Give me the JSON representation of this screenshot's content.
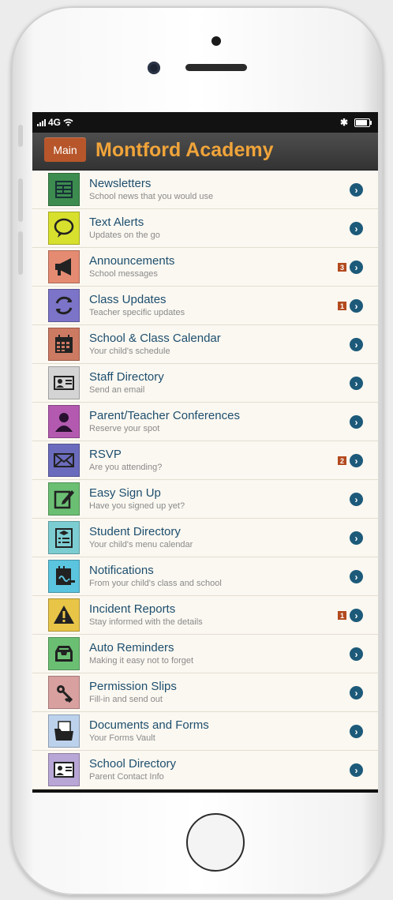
{
  "status_bar": {
    "carrier": "4G"
  },
  "header": {
    "main_button": "Main",
    "title": "Montford Academy"
  },
  "colors": {
    "accent": "#f0a43a",
    "main_button": "#b7562a",
    "badge": "#b34a1e",
    "title_text": "#1d4e6e",
    "chevron": "#1d5a7a"
  },
  "menu": [
    {
      "title": "Newsletters",
      "subtitle": "School news that you would use",
      "icon": "newsletter-icon",
      "tile_color": "#3d8c4f",
      "badge": ""
    },
    {
      "title": "Text Alerts",
      "subtitle": "Updates on the go",
      "icon": "speech-bubble-icon",
      "tile_color": "#d8e02e",
      "badge": ""
    },
    {
      "title": "Announcements",
      "subtitle": "School messages",
      "icon": "megaphone-icon",
      "tile_color": "#e58b72",
      "badge": "3"
    },
    {
      "title": "Class Updates",
      "subtitle": "Teacher specific updates",
      "icon": "refresh-icon",
      "tile_color": "#7c74c8",
      "badge": "1"
    },
    {
      "title": "School & Class Calendar",
      "subtitle": "Your child's schedule",
      "icon": "calendar-icon",
      "tile_color": "#cd7a63",
      "badge": ""
    },
    {
      "title": "Staff Directory",
      "subtitle": "Send an email",
      "icon": "id-card-icon",
      "tile_color": "#d4d4d4",
      "badge": ""
    },
    {
      "title": "Parent/Teacher Conferences",
      "subtitle": "Reserve your spot",
      "icon": "people-icon",
      "tile_color": "#b35ab0",
      "badge": ""
    },
    {
      "title": "RSVP",
      "subtitle": "Are you attending?",
      "icon": "envelope-icon",
      "tile_color": "#6b6bbe",
      "badge": "2"
    },
    {
      "title": "Easy Sign Up",
      "subtitle": "Have you signed up yet?",
      "icon": "edit-icon",
      "tile_color": "#6bbf73",
      "badge": ""
    },
    {
      "title": "Student Directory",
      "subtitle": "Your child's menu calendar",
      "icon": "student-list-icon",
      "tile_color": "#7ccdd2",
      "badge": ""
    },
    {
      "title": "Notifications",
      "subtitle": "From your child's class and school",
      "icon": "notepad-icon",
      "tile_color": "#5bc4df",
      "badge": ""
    },
    {
      "title": "Incident Reports",
      "subtitle": "Stay informed with the details",
      "icon": "warning-icon",
      "tile_color": "#e8c547",
      "badge": "1"
    },
    {
      "title": "Auto Reminders",
      "subtitle": "Making it easy not to forget",
      "icon": "inbox-tray-icon",
      "tile_color": "#6bbf73",
      "badge": ""
    },
    {
      "title": "Permission Slips",
      "subtitle": "Fill-in and send out",
      "icon": "key-icon",
      "tile_color": "#d9a0a0",
      "badge": ""
    },
    {
      "title": "Documents and Forms",
      "subtitle": "Your Forms Vault",
      "icon": "folder-icon",
      "tile_color": "#bcd1ec",
      "badge": ""
    },
    {
      "title": "School Directory",
      "subtitle": "Parent Contact Info",
      "icon": "contact-card-icon",
      "tile_color": "#b8a6d6",
      "badge": ""
    }
  ]
}
